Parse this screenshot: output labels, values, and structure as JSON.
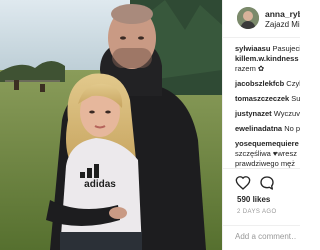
{
  "post": {
    "username": "anna_ryba",
    "location": "Zajazd Mi",
    "photo_shirt_text": "adidas"
  },
  "comments": [
    {
      "user": "sylwiaasu",
      "text": "Pasujecie"
    },
    {
      "user": "killem.w.kindness",
      "text": ""
    },
    {
      "user": "",
      "text": "razem ✿"
    },
    {
      "user": "jacobszlekfcb",
      "text": "Czyl"
    },
    {
      "user": "tomaszczeczek",
      "text": "Su"
    },
    {
      "user": "justynazet",
      "text": "Wyczuv"
    },
    {
      "user": "ewelinadatna",
      "text": "No p"
    },
    {
      "user": "yosequemequiere",
      "text": ""
    },
    {
      "user": "",
      "text": "szczęśliwa ♥wresz"
    },
    {
      "user": "",
      "text": "prawdziwego męż"
    }
  ],
  "actions": {
    "heart_icon": "heart-icon",
    "comment_icon": "comment-icon",
    "likes": "590 likes",
    "time_ago": "2 DAYS AGO",
    "add_comment_placeholder": "Add a comment…"
  },
  "colors": {
    "text": "#262626",
    "muted": "#999999",
    "border": "#efefef"
  }
}
